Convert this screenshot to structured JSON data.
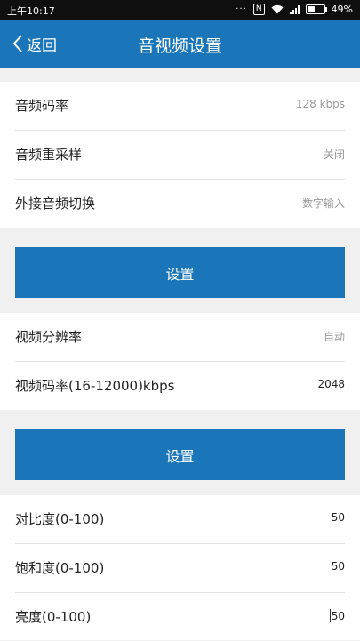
{
  "status": {
    "time": "上午10:17",
    "dots": "···",
    "nfc": "N",
    "battery": "49%",
    "battery_level": 0.49
  },
  "nav": {
    "back_label": "返回",
    "title": "音视频设置"
  },
  "audio": {
    "items": [
      {
        "label": "音频码率",
        "value": "128 kbps"
      },
      {
        "label": "音频重采样",
        "value": "关闭"
      },
      {
        "label": "外接音频切换",
        "value": "数字输入"
      }
    ],
    "set_label": "设置"
  },
  "video": {
    "items": [
      {
        "label": "视频分辨率",
        "value": "自动"
      },
      {
        "label": "视频码率(16-12000)kbps",
        "value": "2048"
      }
    ],
    "set_label": "设置"
  },
  "image": {
    "items": [
      {
        "label": "对比度(0-100)",
        "value": "50"
      },
      {
        "label": "饱和度(0-100)",
        "value": "50"
      },
      {
        "label": "亮度(0-100)",
        "value": "50"
      }
    ]
  },
  "colors": {
    "accent": "#1a76b8",
    "background": "#f0f0f0"
  }
}
